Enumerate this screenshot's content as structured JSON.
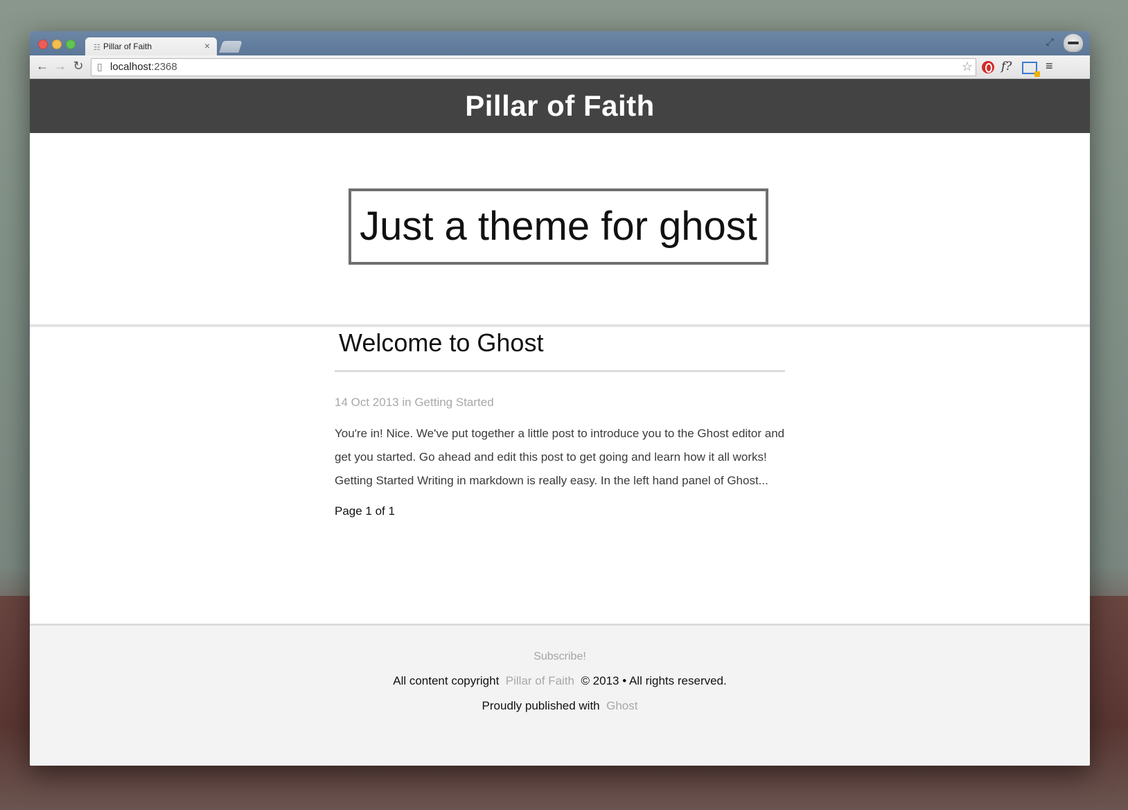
{
  "browser": {
    "tab_title": "Pillar of Faith",
    "tab_close": "×",
    "url_host": "localhost",
    "url_port": ":2368"
  },
  "site": {
    "title": "Pillar of Faith",
    "tagline": "Just a theme for ghost"
  },
  "post": {
    "title": "Welcome to Ghost",
    "date": "14 Oct 2013",
    "meta_in": "in",
    "tag": "Getting Started",
    "excerpt": "You're in! Nice. We've put together a little post to introduce you to the Ghost editor and get you started. Go ahead and edit this post to get going and learn how it all works! Getting Started Writing in markdown is really easy. In the left hand panel of Ghost..."
  },
  "pagination": {
    "text": "Page 1 of 1"
  },
  "footer": {
    "subscribe": "Subscribe!",
    "copyright_prefix": "All content copyright",
    "copyright_link": "Pillar of Faith",
    "copyright_suffix": "© 2013 • All rights reserved.",
    "published_prefix": "Proudly published with",
    "published_link": "Ghost"
  },
  "colors": {
    "header_bg": "#434343",
    "footer_bg": "#f3f3f3",
    "muted_text": "#a8a8a8"
  }
}
